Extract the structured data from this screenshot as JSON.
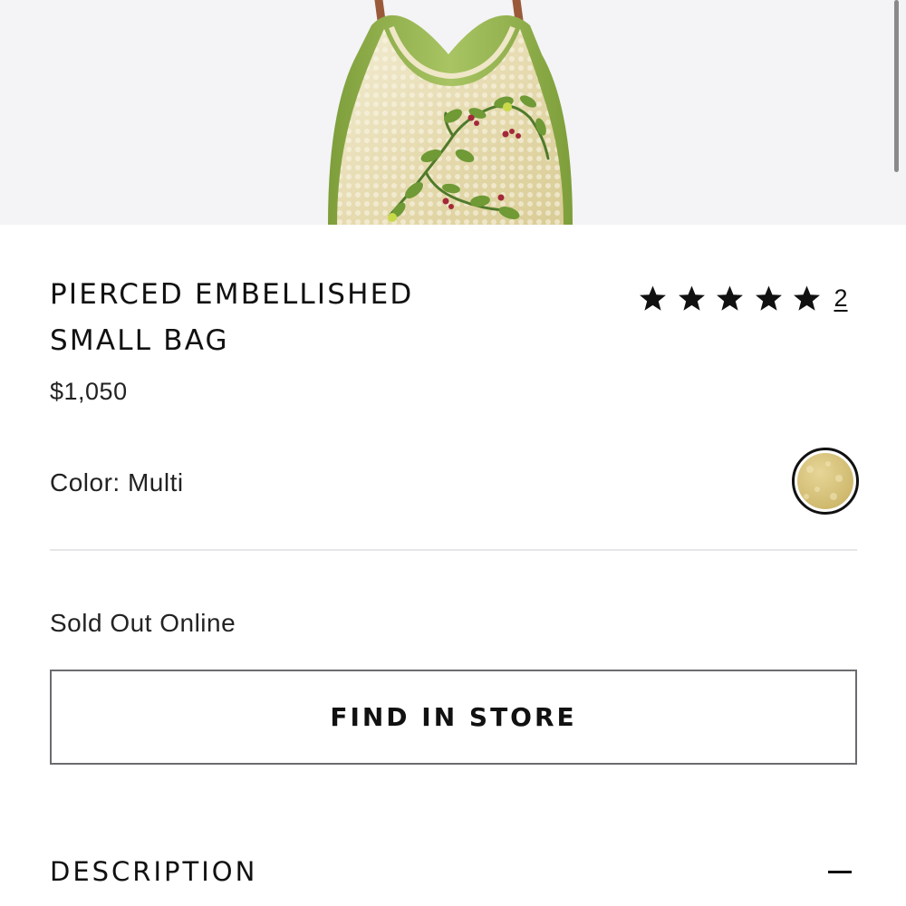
{
  "product": {
    "title_lines": [
      "PIERCED EMBELLISHED",
      "SMALL BAG"
    ],
    "price": "$1,050",
    "rating": {
      "stars": 5,
      "max_stars": 5,
      "review_count": "2"
    },
    "color_label": "Color: Multi",
    "color_swatch_hex": "#d7c27a",
    "availability": "Sold Out Online",
    "find_in_store_label": "FIND IN STORE",
    "description_label": "DESCRIPTION"
  },
  "icons": {
    "star": "star-icon",
    "collapse": "minus-icon"
  },
  "colors": {
    "image_background": "#f4f3f5",
    "bag_body": "#e9dfb3",
    "bag_trim": "#8fb04a",
    "strap": "#9a5a3a",
    "text": "#111111",
    "divider": "#e6e6e8",
    "button_border": "#6b6b70"
  }
}
